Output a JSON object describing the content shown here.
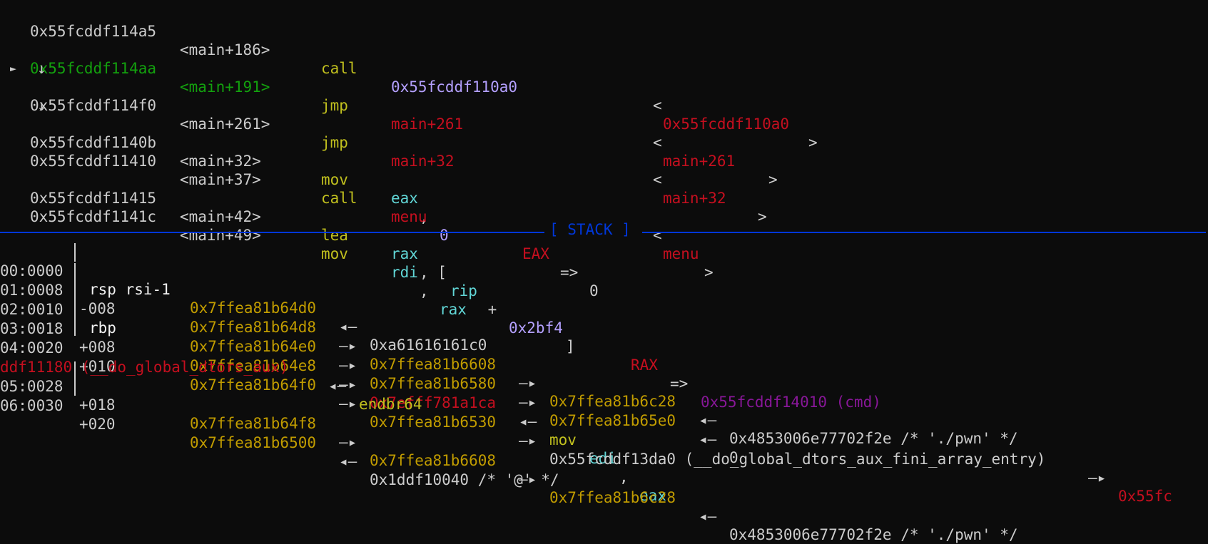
{
  "disasm": {
    "l1": {
      "addr": "0x55fcddf114a5",
      "sym": "<main+186>",
      "op": "call",
      "arg": "0x55fcddf110a0",
      "cmt_open": "<",
      "cmt": "0x55fcddf110a0",
      "cmt_close": ">"
    },
    "l2": {
      "marker": "►",
      "addr": "0x55fcddf114aa",
      "sym": "<main+191>",
      "op": "jmp",
      "arg": "main+261",
      "cmt_open": "<",
      "cmt": "main+261",
      "cmt_close": ">"
    },
    "arrow1": "↓",
    "l3": {
      "addr": "0x55fcddf114f0",
      "sym": "<main+261>",
      "op": "jmp",
      "arg": "main+32",
      "cmt_open": "<",
      "cmt": "main+32",
      "cmt_close": ">"
    },
    "arrow2": "↓",
    "l4": {
      "addr": "0x55fcddf1140b",
      "sym": "<main+32>",
      "op": "mov",
      "reg": "eax",
      "comma": ",",
      "imm": "0",
      "note_reg": "EAX",
      "note_arrow": "=>",
      "note_val": "0"
    },
    "l5": {
      "addr": "0x55fcddf11410",
      "sym": "<main+37>",
      "op": "call",
      "arg": "menu",
      "cmt_open": "<",
      "cmt": "menu",
      "cmt_close": ">"
    },
    "l6": {
      "addr": "0x55fcddf11415",
      "sym": "<main+42>",
      "op": "lea",
      "reg": "rax",
      "comma": ", [",
      "reg2": "rip",
      "plus": " + ",
      "imm": "0x2bf4",
      "close": "]",
      "note_reg": "RAX",
      "note_arrow": "=>",
      "note_val": "0x55fcddf14010 (cmd)"
    },
    "l7": {
      "addr": "0x55fcddf1141c",
      "sym": "<main+49>",
      "op": "mov",
      "reg": "rdi",
      "comma": ",",
      "reg2": "rax"
    }
  },
  "separator": {
    "label": "[ STACK ]"
  },
  "stack": {
    "r0": {
      "idx": "00:0000",
      "off": "rsp rsi-1",
      "a1": "0x7ffea81b64d0",
      "arr1": "◂—",
      "v": "0xa61616161c0"
    },
    "r1": {
      "idx": "01:0008",
      "off": "-008",
      "a1": "0x7ffea81b64d8",
      "arr1": "—▸",
      "a2": "0x7ffea81b6608",
      "arr2": "—▸",
      "a3": "0x7ffea81b6c28",
      "arr3": "◂—",
      "v": "0x4853006e77702f2e /* './pwn' */"
    },
    "r2": {
      "idx": "02:0010",
      "off": "rbp",
      "a1": "0x7ffea81b64e0",
      "arr1": "—▸",
      "a2": "0x7ffea81b6580",
      "arr2": "—▸",
      "a3": "0x7ffea81b65e0",
      "arr3": "◂—",
      "v": "0"
    },
    "r3": {
      "idx": "03:0018",
      "off": "+008",
      "a1": "0x7ffea81b64e8",
      "arr1": "—▸",
      "a2": "0x7efff781a1ca",
      "arr2": "◂—",
      "ins": "mov",
      "reg": "edi",
      "comma": ",",
      "reg2": "eax"
    },
    "r4": {
      "idx": "04:0020",
      "off": "+010",
      "a1": "0x7ffea81b64f0",
      "arr1": "—▸",
      "a2": "0x7ffea81b6530",
      "arr2": "—▸",
      "a3": "0x55fcddf13da0 (__do_global_dtors_aux_fini_array_entry)",
      "arr3": "—▸",
      "a4": "0x55fc"
    },
    "r4b": {
      "cont": "ddf11180 (__do_global_dtors_aux)",
      "arr": "◂—",
      "ins": "endbr64"
    },
    "r5": {
      "idx": "05:0028",
      "off": "+018",
      "a1": "0x7ffea81b64f8",
      "arr1": "—▸",
      "a2": "0x7ffea81b6608",
      "arr2": "—▸",
      "a3": "0x7ffea81b6c28",
      "arr3": "◂—",
      "v": "0x4853006e77702f2e /* './pwn' */"
    },
    "r6": {
      "idx": "06:0030",
      "off": "+020",
      "a1": "0x7ffea81b6500",
      "arr1": "◂—",
      "v": "0x1ddf10040 /* '@' */"
    }
  }
}
